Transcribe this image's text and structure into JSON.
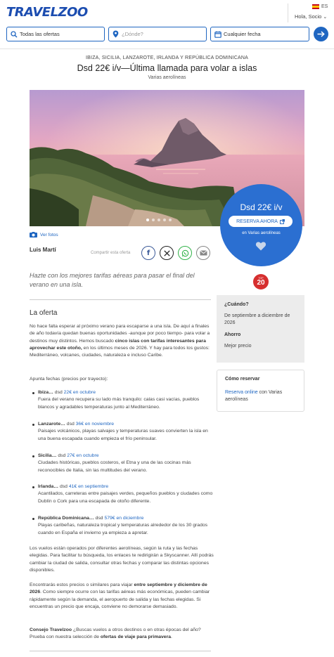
{
  "header": {
    "logo": "TRAVELZOO",
    "language": "ES",
    "greeting": "Hola, Socio",
    "search": {
      "offers": "Todas las ofertas",
      "where_placeholder": "¿Dónde?",
      "date": "Cualquier fecha"
    }
  },
  "deal": {
    "kicker": "IBIZA, SICILIA, LANZAROTE, IRLANDA Y REPÚBLICA DOMINICANA",
    "title": "Dsd 22€ i/v—Última llamada para volar a islas",
    "airline": "Varias aerolíneas",
    "price": "Dsd 22€ i/v",
    "book_button": "RESERVA AHORA",
    "book_airline": "en Varias aerolíneas",
    "photos_label": "Ver fotos",
    "author": "Luis Martí",
    "share_label": "Compartir esta oferta",
    "badge_top": "TOP",
    "badge_num": "20",
    "lead": "Hazte con los mejores tarifas aéreas para pasar el final del verano en una isla."
  },
  "offer": {
    "heading": "La oferta",
    "intro_1": "No hace falta esperar al próximo verano para escaparse a una isla. De aquí a finales de año todavía quedan buenas oportunidades -aunque por poco tiempo- para volar a destinos muy distintos. Hemos buscado ",
    "intro_bold": "cinco islas con tarifas interesantes para aprovechar este otoño,",
    "intro_2": " en los últimos meses de 2026. Y hay para todos los gustos: Mediterráneo, volcanes, ciudades, naturaleza e incluso Caribe.",
    "prices_note": "Apunta fechas (precios por trayecto):",
    "items": [
      {
        "name": "Ibiza…",
        "price_prefix": " dsd ",
        "price": "22€ en octubre",
        "desc": "Fuera del verano recupera su lado más tranquilo: calas casi vacías, pueblos blancos y agradables temperaturas junto al Mediterráneo."
      },
      {
        "name": "Lanzarote…",
        "price_prefix": " dsd ",
        "price": "36€ en noviembre",
        "desc": "Paisajes volcánicos, playas salvajes y temperaturas suaves convierten la isla en una buena escapada cuando empieza el frío peninsular."
      },
      {
        "name": "Sicilia…",
        "price_prefix": " dsd ",
        "price": "27€ en octubre",
        "desc": "Ciudades históricas, pueblos costeros, el Etna y una de las cocinas más reconocibles de Italia, sin las multitudes del verano."
      },
      {
        "name": "Irlanda…",
        "price_prefix": " dsd ",
        "price": "41€ en septiembre",
        "desc": "Acantilados, carreteras entre paisajes verdes, pequeños pueblos y ciudades como Dublín o Cork para una escapada de otoño diferente."
      },
      {
        "name": "República Dominicana…",
        "price_prefix": " dsd ",
        "price": "579€ en diciembre",
        "desc": "Playas caribeñas, naturaleza tropical y temperaturas alrededor de los 30 grados cuando en España el invierno ya empieza a apretar."
      }
    ],
    "flights_note": "Los vuelos están operados por diferentes aerolíneas, según la ruta y las fechas elegidas. Para facilitar tu búsqueda, los enlaces te redirigirán a Skyscanner. Allí podrás cambiar la ciudad de salida, consultar otras fechas y comparar las distintas opciones disponibles.",
    "dates_1": "Encontrarás estos precios o similares para viajar ",
    "dates_bold": "entre septiembre y diciembre de 2026",
    "dates_2": ". Como siempre ocurre con las tarifas aéreas más económicas, pueden cambiar rápidamente según la demanda, el aeropuerto de salida y las fechas elegidas. Si encuentras un precio que encaja, conviene no demorarse demasiado.",
    "tip_label": "Consejo Travelzoo",
    "tip_text": " ¿Buscas vuelos a otros destinos o en otras épocas del año? Prueba con nuestra selección de ",
    "tip_link": "ofertas de viaje para primavera",
    "tip_end": "."
  },
  "sidebar": {
    "when_heading": "¿Cuándo?",
    "when_value": "De septiembre a diciembre de 2026",
    "alert_heading": "Ahorro",
    "alert_value": "Mejor precio",
    "how_heading": "Cómo reservar",
    "how_link": "Reserva online",
    "how_text": " con Varias aerolíneas"
  },
  "colors": {
    "brand": "#1f66c1",
    "badge": "#d62f2f"
  },
  "icons": [
    "search-icon",
    "pin-icon",
    "calendar-icon",
    "arrow-right-icon",
    "camera-icon",
    "facebook-icon",
    "x-icon",
    "whatsapp-icon",
    "mail-icon",
    "heart-icon",
    "external-link-icon"
  ]
}
